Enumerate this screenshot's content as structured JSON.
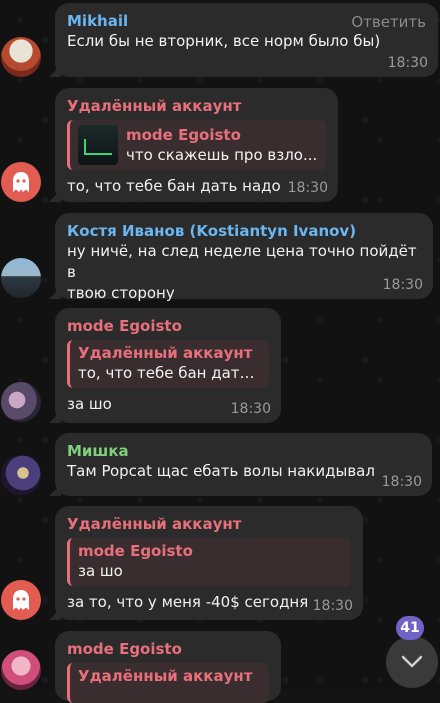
{
  "messages": [
    {
      "sender": "Mikhail",
      "reply_action": "Ответить",
      "text": "Если бы не вторник, все норм было бы)",
      "time": "18:30"
    },
    {
      "sender": "Удалённый аккаунт",
      "quote": {
        "sender": "mode Egoisto",
        "text": "что скажешь про взло..."
      },
      "text": "то, что тебе бан дать надо",
      "time": "18:30"
    },
    {
      "sender": "Костя Иванов (Kostiantyn Ivanov)",
      "text_line1": "ну ничё, на след неделе цена точно пойдёт в",
      "text_line2": "твою сторону",
      "time": "18:30"
    },
    {
      "sender": "mode Egoisto",
      "quote": {
        "sender": "Удалённый аккаунт",
        "text": "то, что тебе бан дать ..."
      },
      "text": "за шо",
      "time": "18:30"
    },
    {
      "sender": "Мишка",
      "text": "Там Popcat щас ебать волы накидывал",
      "time": "18:30"
    },
    {
      "sender": "Удалённый аккаунт",
      "quote": {
        "sender": "mode Egoisto",
        "text": "за шо"
      },
      "text": "за то, что у меня -40$ сегодня",
      "time": "18:30"
    },
    {
      "sender": "mode Egoisto",
      "quote": {
        "sender": "Удалённый аккаунт"
      }
    }
  ],
  "unread_count": "41",
  "colors": {
    "blue": "#6bb6f0",
    "red": "#e8707a",
    "green": "#7fd07a",
    "bubble": "#2b2b2b",
    "badge": "#6f63c8"
  }
}
